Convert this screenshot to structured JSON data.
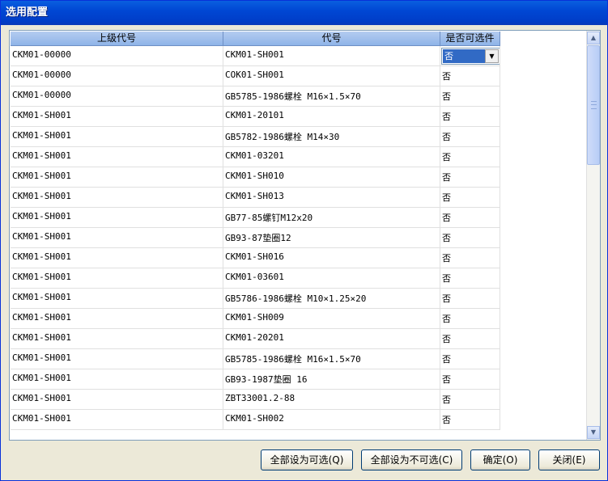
{
  "window": {
    "title": "选用配置"
  },
  "grid": {
    "columns": [
      "上级代号",
      "代号",
      "是否可选件"
    ],
    "rows": [
      [
        "CKM01-00000",
        "CKM01-SH001",
        "否"
      ],
      [
        "CKM01-00000",
        "COK01-SH001",
        "否"
      ],
      [
        "CKM01-00000",
        "GB5785-1986螺栓 M16×1.5×70",
        "否"
      ],
      [
        "CKM01-SH001",
        "CKM01-20101",
        "否"
      ],
      [
        "CKM01-SH001",
        "GB5782-1986螺栓 M14×30",
        "否"
      ],
      [
        "CKM01-SH001",
        "CKM01-03201",
        "否"
      ],
      [
        "CKM01-SH001",
        "CKM01-SH010",
        "否"
      ],
      [
        "CKM01-SH001",
        "CKM01-SH013",
        "否"
      ],
      [
        "CKM01-SH001",
        "GB77-85螺钉M12x20",
        "否"
      ],
      [
        "CKM01-SH001",
        "GB93-87垫圈12",
        "否"
      ],
      [
        "CKM01-SH001",
        "CKM01-SH016",
        "否"
      ],
      [
        "CKM01-SH001",
        "CKM01-03601",
        "否"
      ],
      [
        "CKM01-SH001",
        "GB5786-1986螺栓 M10×1.25×20",
        "否"
      ],
      [
        "CKM01-SH001",
        "CKM01-SH009",
        "否"
      ],
      [
        "CKM01-SH001",
        "CKM01-20201",
        "否"
      ],
      [
        "CKM01-SH001",
        "GB5785-1986螺栓 M16×1.5×70",
        "否"
      ],
      [
        "CKM01-SH001",
        "GB93-1987垫圈 16",
        "否"
      ],
      [
        "CKM01-SH001",
        "ZBT33001.2-88",
        "否"
      ],
      [
        "CKM01-SH001",
        "CKM01-SH002",
        "否"
      ]
    ],
    "active_cell_value": "否"
  },
  "buttons": {
    "set_all_optional": "全部设为可选(Q)",
    "set_all_not_optional": "全部设为不可选(C)",
    "ok": "确定(O)",
    "close": "关闭(E)"
  },
  "icons": {
    "scroll_up": "scroll-up-icon",
    "scroll_down": "scroll-down-icon",
    "dropdown": "chevron-down-icon"
  }
}
